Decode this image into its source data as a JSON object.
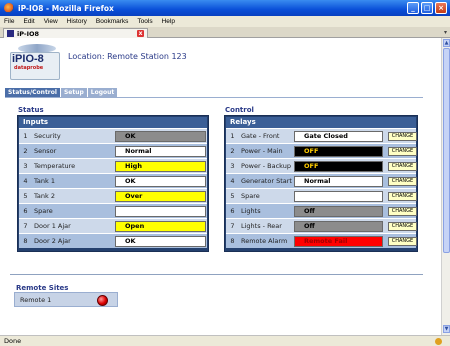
{
  "window": {
    "title": "iP-IO8 - Mozilla Firefox",
    "min": "_",
    "max": "□",
    "close": "×"
  },
  "menu": [
    "File",
    "Edit",
    "View",
    "History",
    "Bookmarks",
    "Tools",
    "Help"
  ],
  "tab": {
    "label": "iP-IO8",
    "close": "x"
  },
  "tab_scroll": "▾",
  "status": "Done",
  "page": {
    "logo": {
      "main": "iPIO-8",
      "sub": "dataprobe"
    },
    "location": "Location: Remote Station 123",
    "nav": [
      "Status/Control",
      "Setup",
      "Logout"
    ],
    "status_title": "Status",
    "control_title": "Control",
    "inputs_header": "Inputs",
    "relays_header": "Relays",
    "inputs": [
      {
        "num": "1",
        "label": "Security",
        "value": "OK",
        "state": "gray"
      },
      {
        "num": "2",
        "label": "Sensor",
        "value": "Normal",
        "state": "white"
      },
      {
        "num": "3",
        "label": "Temperature",
        "value": "High",
        "state": "yellow"
      },
      {
        "num": "4",
        "label": "Tank 1",
        "value": "OK",
        "state": "white"
      },
      {
        "num": "5",
        "label": "Tank 2",
        "value": "Over",
        "state": "yellow"
      },
      {
        "num": "6",
        "label": "Spare",
        "value": "",
        "state": "white"
      },
      {
        "num": "7",
        "label": "Door 1 Ajar",
        "value": "Open",
        "state": "yellow"
      },
      {
        "num": "8",
        "label": "Door 2 Ajar",
        "value": "OK",
        "state": "white"
      }
    ],
    "relays": [
      {
        "num": "1",
        "label": "Gate - Front",
        "value": "Gate Closed",
        "state": "white",
        "button": "CHANGE"
      },
      {
        "num": "2",
        "label": "Power - Main",
        "value": "OFF",
        "state": "black",
        "button": "CHANGE"
      },
      {
        "num": "3",
        "label": "Power - Backup",
        "value": "OFF",
        "state": "black",
        "button": "CHANGE"
      },
      {
        "num": "4",
        "label": "Generator Start",
        "value": "Normal",
        "state": "white",
        "button": "CHANGE"
      },
      {
        "num": "5",
        "label": "Spare",
        "value": "",
        "state": "white",
        "button": "CHANGE"
      },
      {
        "num": "6",
        "label": "Lights",
        "value": "Off",
        "state": "gray",
        "button": "CHANGE"
      },
      {
        "num": "7",
        "label": "Lights - Rear",
        "value": "Off",
        "state": "gray",
        "button": "CHANGE"
      },
      {
        "num": "8",
        "label": "Remote Alarm",
        "value": "Remote Fail",
        "state": "red",
        "button": "CHANGE"
      }
    ],
    "remote_title": "Remote Sites",
    "remote_sites": [
      {
        "label": "Remote 1",
        "status_color": "#dd0000"
      }
    ]
  },
  "colors": {
    "gray": "#8c8c8c",
    "white": "#ffffff",
    "yellow": "#ffff00",
    "black": "#000000",
    "red": "#ff0000",
    "text_dark": "#000000",
    "text_orange": "#ffcc00",
    "text_light": "#ffffff",
    "text_red": "#a00000"
  }
}
